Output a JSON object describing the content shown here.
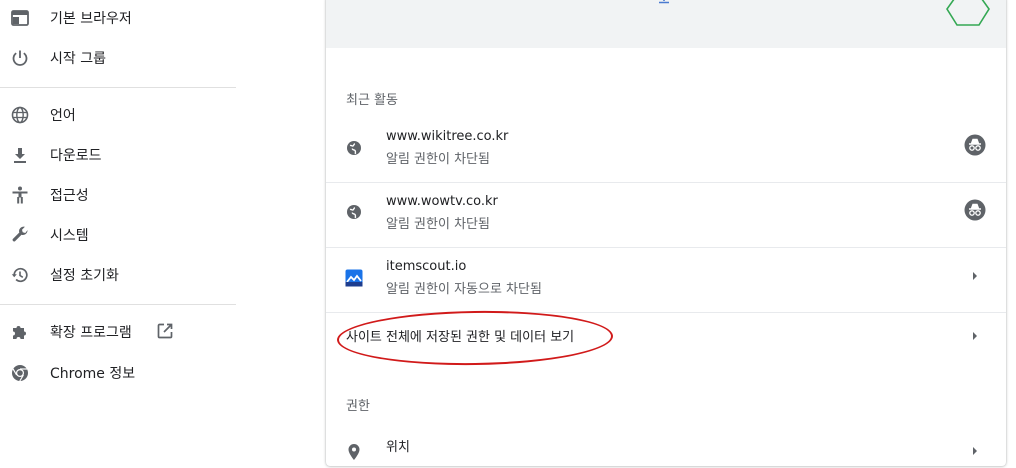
{
  "sidebar": {
    "items": [
      {
        "label": "기본 브라우저",
        "icon": "browser-window-icon"
      },
      {
        "label": "시작 그룹",
        "icon": "power-icon"
      },
      {
        "label": "언어",
        "icon": "globe-icon"
      },
      {
        "label": "다운로드",
        "icon": "download-icon"
      },
      {
        "label": "접근성",
        "icon": "accessibility-icon"
      },
      {
        "label": "시스템",
        "icon": "wrench-icon"
      },
      {
        "label": "설정 초기화",
        "icon": "restore-icon"
      },
      {
        "label": "확장 프로그램",
        "icon": "puzzle-icon"
      },
      {
        "label": "Chrome 정보",
        "icon": "chrome-icon"
      }
    ]
  },
  "main": {
    "recent_title": "최근 활동",
    "recent": [
      {
        "site": "www.wikitree.co.kr",
        "status": "알림 권한이 차단됨"
      },
      {
        "site": "www.wowtv.co.kr",
        "status": "알림 권한이 차단됨"
      },
      {
        "site": "itemscout.io",
        "status": "알림 권한이 자동으로 차단됨"
      }
    ],
    "all_sites_label": "사이트 전체에 저장된 권한 및 데이터 보기",
    "permissions_title": "권한",
    "permissions": [
      {
        "label": "위치"
      }
    ]
  },
  "colors": {
    "annotation": "#d11a1a",
    "icon_gray": "#5f6368",
    "hexagon": "#34a853",
    "accent": "#1a73e8"
  }
}
